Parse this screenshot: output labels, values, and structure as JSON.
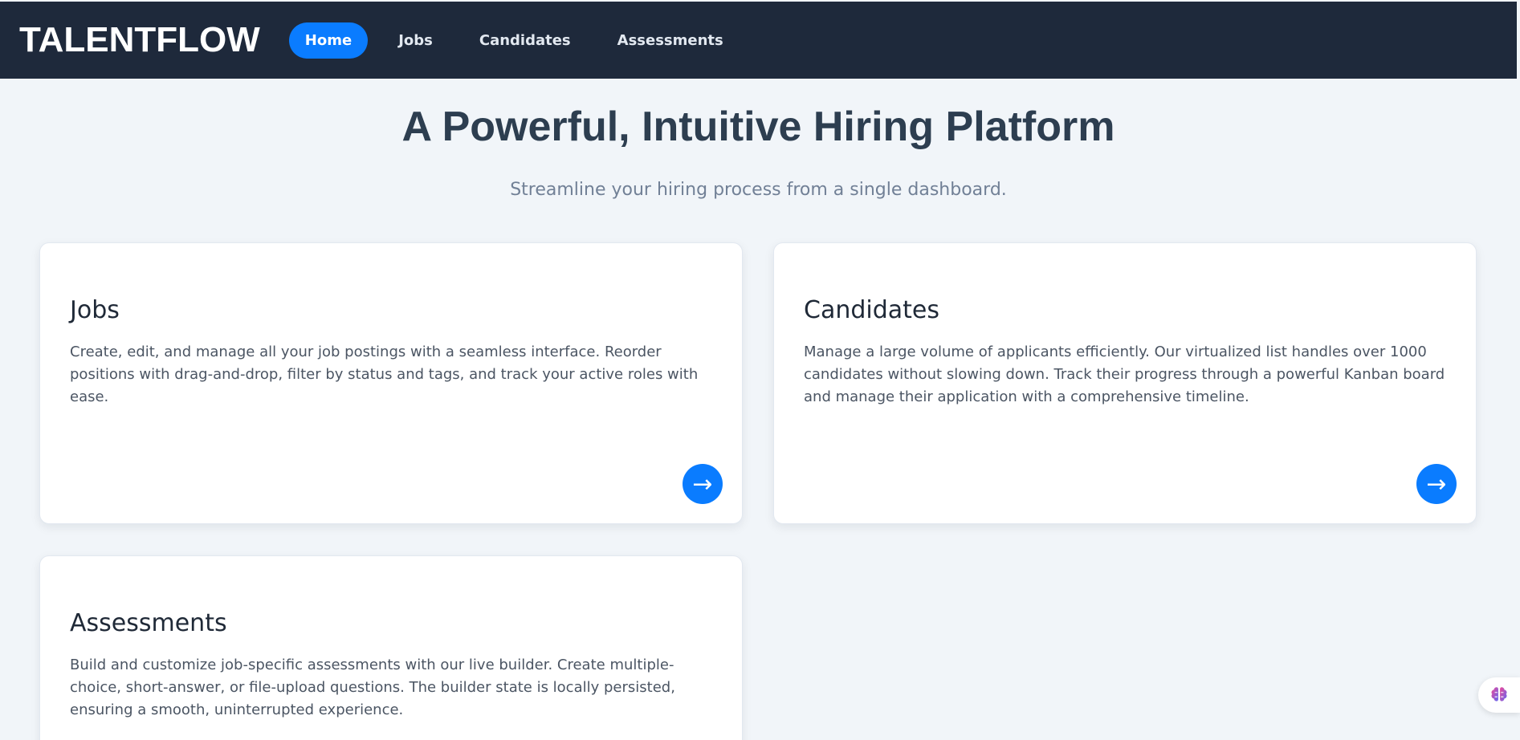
{
  "brand": "TALENTFLOW",
  "nav": {
    "items": [
      {
        "label": "Home",
        "active": true
      },
      {
        "label": "Jobs",
        "active": false
      },
      {
        "label": "Candidates",
        "active": false
      },
      {
        "label": "Assessments",
        "active": false
      }
    ]
  },
  "hero": {
    "title": "A Powerful, Intuitive Hiring Platform",
    "subtitle": "Streamline your hiring process from a single dashboard."
  },
  "cards": {
    "jobs": {
      "title": "Jobs",
      "description": "Create, edit, and manage all your job postings with a seamless interface. Reorder positions with drag-and-drop, filter by status and tags, and track your active roles with ease.",
      "action_icon": "arrow-right-icon"
    },
    "candidates": {
      "title": "Candidates",
      "description": "Manage a large volume of applicants efficiently. Our virtualized list handles over 1000 candidates without slowing down. Track their progress through a powerful Kanban board and manage their application with a comprehensive timeline.",
      "action_icon": "arrow-right-icon"
    },
    "assessments": {
      "title": "Assessments",
      "description": "Build and customize job-specific assessments with our live builder. Create multiple-choice, short-answer, or file-upload questions. The builder state is locally persisted, ensuring a smooth, uninterrupted experience."
    }
  },
  "widget": {
    "icon": "brain-icon"
  },
  "colors": {
    "navbar_bg": "#1e293b",
    "accent": "#0a7cff",
    "page_bg": "#f1f5f9",
    "title": "#2d3e50"
  }
}
